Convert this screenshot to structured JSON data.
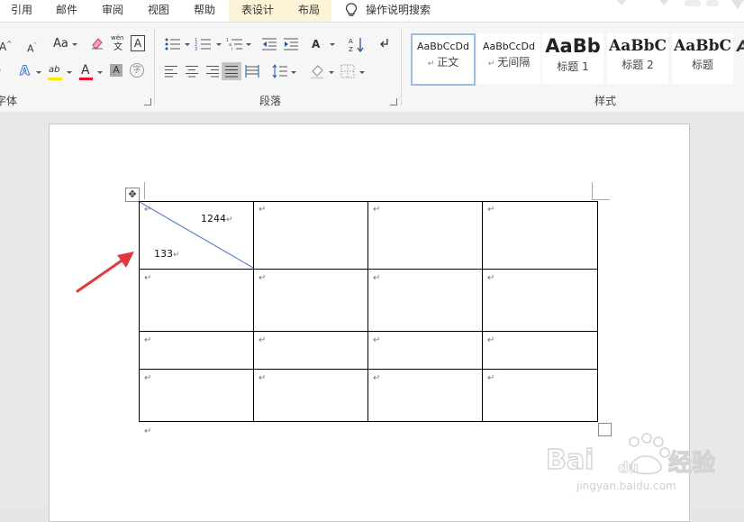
{
  "ribbon_tabs": {
    "references": "引用",
    "mailings": "邮件",
    "review": "审阅",
    "view": "视图",
    "help": "帮助",
    "table_design": "表设计",
    "layout": "布局",
    "tell_me": "操作说明搜索"
  },
  "font_group": {
    "label": "字体",
    "change_case": "Aa",
    "phonetic_top": "wén",
    "phonetic_bottom": "文",
    "char_border": "A",
    "text_effects": "A",
    "highlight": "ab",
    "font_color": "A",
    "char_shading": "A",
    "enclose_char": "字"
  },
  "paragraph_group": {
    "label": "段落"
  },
  "styles_group": {
    "label": "样式",
    "items": [
      {
        "preview": "AaBbCcDd",
        "name": "正文"
      },
      {
        "preview": "AaBbCcDd",
        "name": "无间隔"
      },
      {
        "preview": "AaBb",
        "name": "标题 1"
      },
      {
        "preview": "AaBbC",
        "name": "标题 2"
      },
      {
        "preview": "AaBbC",
        "name": "标题"
      }
    ]
  },
  "document": {
    "paragraph_mark": "↵",
    "table": {
      "diagonal_top_value": "1244",
      "diagonal_bottom_value": "133",
      "rows": 4,
      "cols": 4
    }
  },
  "colors": {
    "diagonal_line": "#5b85c4",
    "arrow": "#e0393e",
    "highlight_bar": "#ffe800",
    "font_color_bar": "#e81123"
  }
}
